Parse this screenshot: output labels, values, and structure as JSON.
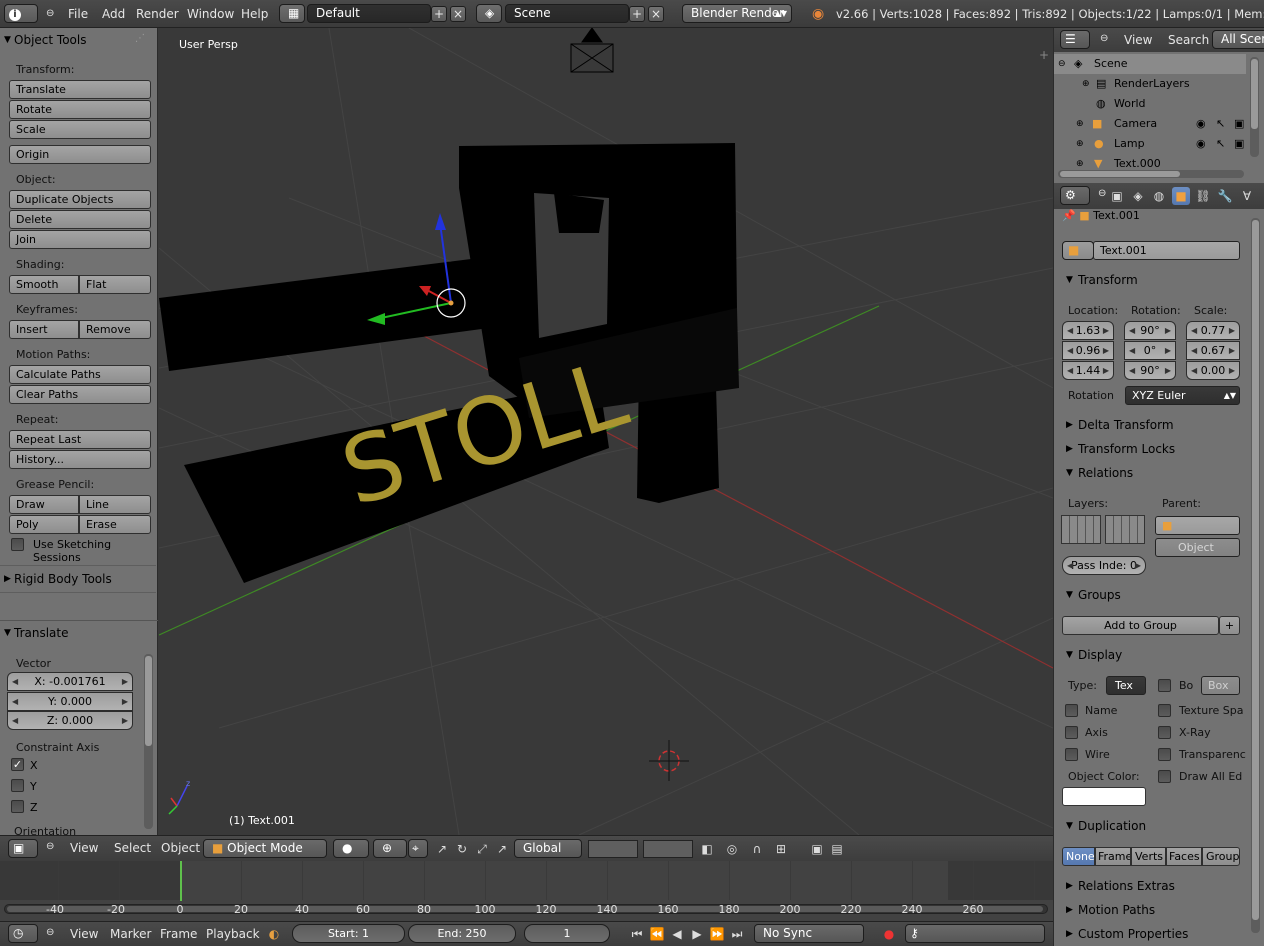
{
  "topbar": {
    "menu": [
      "File",
      "Add",
      "Render",
      "Window",
      "Help"
    ],
    "layout": "Default",
    "scene": "Scene",
    "engine": "Blender Render",
    "stats": "v2.66 | Verts:1028 | Faces:892 | Tris:892 | Objects:1/22 | Lamps:0/1 | Mem:16.43M ("
  },
  "toolshelf": {
    "title": "Object Tools",
    "transform_label": "Transform:",
    "translate": "Translate",
    "rotate": "Rotate",
    "scale": "Scale",
    "origin": "Origin",
    "object_label": "Object:",
    "duplicate": "Duplicate Objects",
    "delete": "Delete",
    "join": "Join",
    "shading_label": "Shading:",
    "smooth": "Smooth",
    "flat": "Flat",
    "keyframes_label": "Keyframes:",
    "insert": "Insert",
    "remove": "Remove",
    "motion_label": "Motion Paths:",
    "calc_paths": "Calculate Paths",
    "clear_paths": "Clear Paths",
    "repeat_label": "Repeat:",
    "repeat_last": "Repeat Last",
    "history": "History...",
    "grease_label": "Grease Pencil:",
    "draw": "Draw",
    "line": "Line",
    "poly": "Poly",
    "erase": "Erase",
    "sketch": "Use Sketching Sessions",
    "rigid": "Rigid Body Tools"
  },
  "operator": {
    "title": "Translate",
    "vector_label": "Vector",
    "x": "X: -0.001761",
    "y": "Y: 0.000",
    "z": "Z: 0.000",
    "constraint_label": "Constraint Axis",
    "cx": "X",
    "cy": "Y",
    "cz": "Z",
    "cx_checked": true,
    "orientation_label": "Orientation"
  },
  "viewport": {
    "view_name": "User Persp",
    "object_label": "(1) Text.001",
    "text_object": "STOLL",
    "text_color": "#a99530"
  },
  "header3d": {
    "menu": [
      "View",
      "Select",
      "Object"
    ],
    "mode": "Object Mode",
    "orientation": "Global"
  },
  "timeline": {
    "ticks": [
      "-40",
      "-20",
      "0",
      "20",
      "40",
      "60",
      "80",
      "100",
      "120",
      "140",
      "160",
      "180",
      "200",
      "220",
      "240",
      "260"
    ],
    "current_frame_marker": 0
  },
  "tlheader": {
    "menu": [
      "View",
      "Marker",
      "Frame",
      "Playback"
    ],
    "start": "Start: 1",
    "end": "End: 250",
    "current": "1",
    "sync": "No Sync"
  },
  "outliner": {
    "menu": [
      "View",
      "Search"
    ],
    "filter": "All Scenes",
    "rows": [
      "Scene",
      "RenderLayers",
      "World",
      "Camera",
      "Lamp",
      "Text.000"
    ]
  },
  "properties": {
    "breadcrumb": "Text.001",
    "object_name": "Text.001",
    "transform": "Transform",
    "location_label": "Location:",
    "rotation_label": "Rotation:",
    "scale_label": "Scale:",
    "location": [
      "1.63",
      "0.96",
      "1.44"
    ],
    "rotation": [
      "90°",
      "0°",
      "90°"
    ],
    "scale": [
      "0.77",
      "0.67",
      "0.00"
    ],
    "rotation_mode_label": "Rotation",
    "rotation_mode": "XYZ Euler",
    "delta": "Delta Transform",
    "locks": "Transform Locks",
    "relations": "Relations",
    "layers_label": "Layers:",
    "parent_label": "Parent:",
    "parent_type": "Object",
    "pass_index": "Pass Inde: 0",
    "groups": "Groups",
    "add_group": "Add to Group",
    "display": "Display",
    "type_label": "Type:",
    "type_value": "Tex",
    "bo": "Bo",
    "box": "Box",
    "name": "Name",
    "texture_space": "Texture Spa",
    "axis": "Axis",
    "xray": "X-Ray",
    "wire": "Wire",
    "transparency": "Transparenc",
    "object_color_label": "Object Color:",
    "draw_all": "Draw All Ed",
    "duplication": "Duplication",
    "dup_options": [
      "None",
      "Frame",
      "Verts",
      "Faces",
      "Group"
    ],
    "relations_extras": "Relations Extras",
    "motion_paths": "Motion Paths",
    "custom_props": "Custom Properties"
  }
}
